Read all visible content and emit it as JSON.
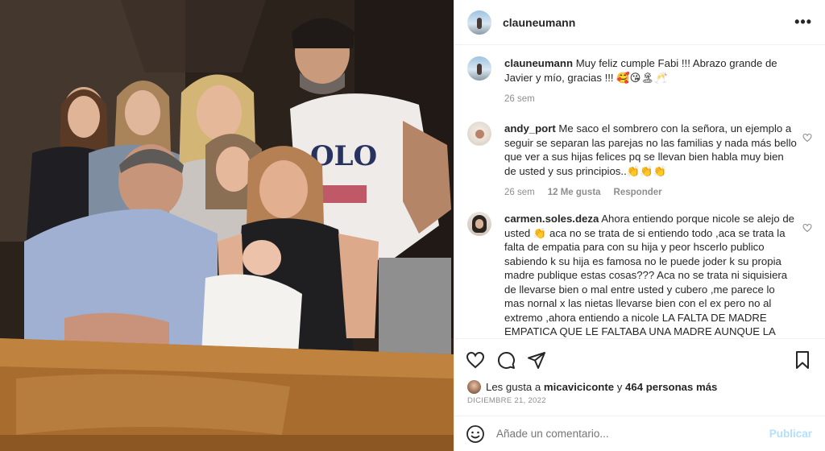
{
  "post": {
    "author": "clauneumann",
    "more_icon": "more-horizontal-icon"
  },
  "comments": [
    {
      "username": "clauneumann",
      "text": "Muy feliz cumple Fabi !!! Abrazo grande de Javier y mío, gracias !!! 🥰😘🏝🥂",
      "time": "26 sem",
      "likes": "",
      "reply": ""
    },
    {
      "username": "andy_port",
      "text": "Me saco el sombrero con la señora, un ejemplo a seguir se separan las parejas no las familias y nada más bello que ver a sus hijas felices pq se llevan bien habla muy bien de usted y sus principios..👏👏👏",
      "time": "26 sem",
      "likes": "12 Me gusta",
      "reply": "Responder"
    },
    {
      "username": "carmen.soles.deza",
      "text": "Ahora entiendo porque nicole se alejo de usted 👏 aca no se trata de si entiendo todo ,aca se trata la falta de empatia para con su hija y peor hscerlo publico sabiendo k su hija es famosa no le puede joder k su propia madre publique estas cosas??? Aca no se trata ni siquisiera de llevarse bien o mal entre usted y cubero ,me parece lo mas nornal x las nietas llevarse bien con el ex pero no al extremo ,ahora entiendo a nicole LA FALTA DE MADRE EMPATICA QUE LE FALTABA UNA MADRE AUNQUE LA HIJA SE EQUIVOCA NO ESTA EN EL OTRO BANDO, APOYO A SU",
      "time": "",
      "likes": "",
      "reply": ""
    }
  ],
  "actions": {
    "like_icon": "heart-icon",
    "comment_icon": "comment-icon",
    "share_icon": "share-icon",
    "save_icon": "bookmark-icon"
  },
  "likes": {
    "prefix": "Les gusta a",
    "user": "micaviciconte",
    "joiner": "y",
    "others": "464 personas más"
  },
  "date": "DICIEMBRE 21, 2022",
  "add_comment": {
    "placeholder": "Añade un comentario...",
    "publish": "Publicar"
  }
}
